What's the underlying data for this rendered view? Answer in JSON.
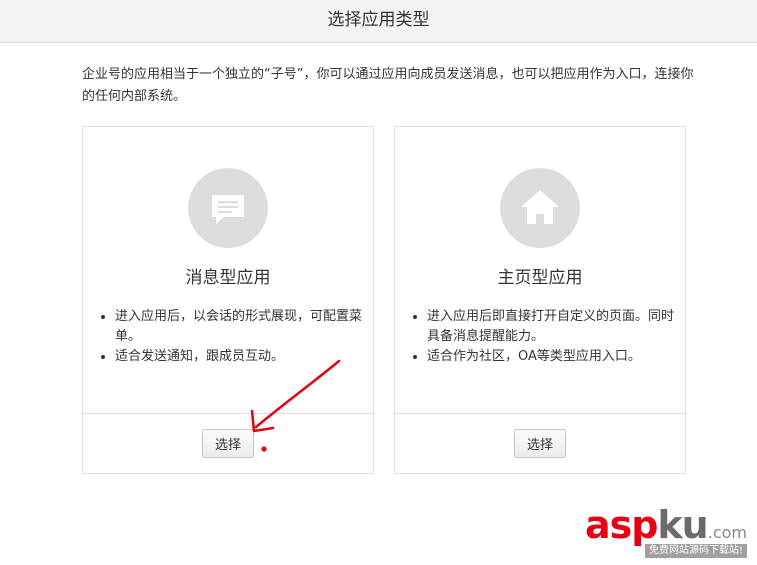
{
  "header": {
    "title": "选择应用类型"
  },
  "intro": {
    "text": "企业号的应用相当于一个独立的“子号”，你可以通过应用向成员发送消息，也可以把应用作为入口，连接你的任何内部系统。"
  },
  "cards": [
    {
      "title": "消息型应用",
      "icon": "message-icon",
      "bullets": [
        "进入应用后，以会话的形式展现，可配置菜单。",
        "适合发送通知，跟成员互动。"
      ],
      "button_label": "选择"
    },
    {
      "title": "主页型应用",
      "icon": "home-icon",
      "bullets": [
        "进入应用后即直接打开自定义的页面。同时具备消息提醒能力。",
        "适合作为社区，OA等类型应用入口。"
      ],
      "button_label": "选择"
    }
  ],
  "annotation": {
    "color": "#e60012"
  },
  "watermark": {
    "brand_asp": "asp",
    "brand_ku": "ku",
    "brand_com": ".com",
    "tagline": "免费网站源码下载站!"
  },
  "colors": {
    "header_bg": "#f3f3f3",
    "border": "#dcdcdc",
    "icon_circle": "#dcdcdc",
    "accent_red": "#e60012"
  }
}
